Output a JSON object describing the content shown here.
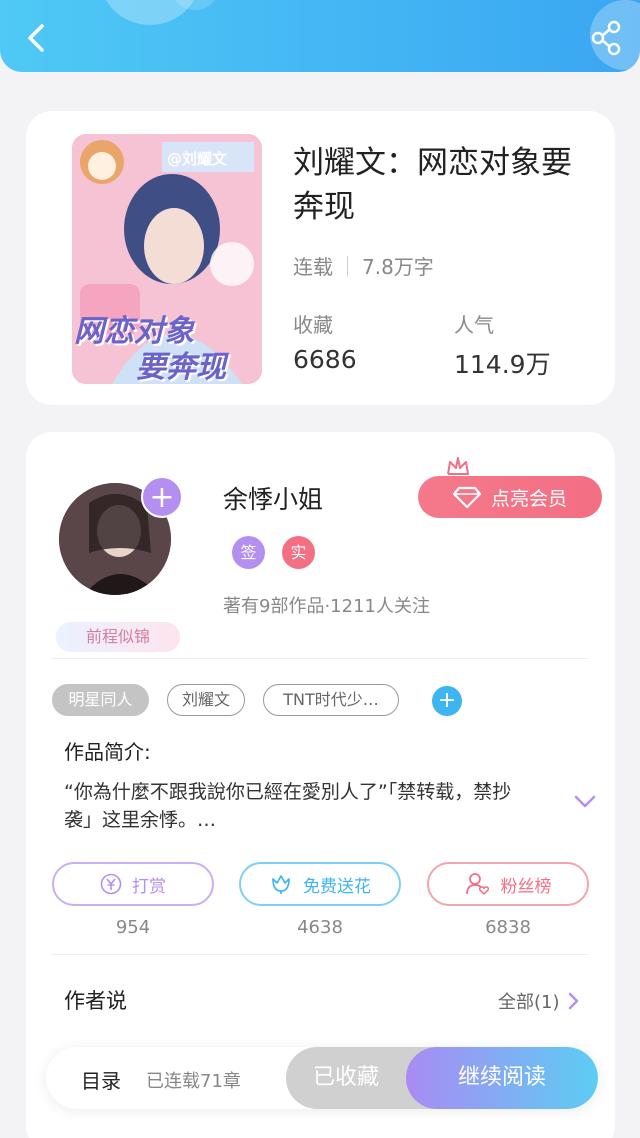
{
  "header": {
    "accent_color": "#3aa6f2",
    "back_icon": "chevron-left-icon",
    "share_icon": "share-icon"
  },
  "book": {
    "title": "刘耀文：网恋对象要奔现",
    "status": "连载",
    "word_count": "7.8万字",
    "collect_label": "收藏",
    "collect_value": "6686",
    "popularity_label": "人气",
    "popularity_value": "114.9万",
    "cover_text_1": "网恋对象",
    "cover_text_2": "要奔现",
    "cover_watermark": "@刘耀文"
  },
  "author": {
    "name": "余悸小姐",
    "badge_sign": "签",
    "badge_real": "实",
    "stats": "著有9部作品·1211人关注",
    "vip_button": "点亮会员",
    "honor_tag": "前程似锦"
  },
  "tags": [
    "明星同人",
    "刘耀文",
    "TNT时代少…"
  ],
  "intro": {
    "label": "作品简介:",
    "text": "“你為什麼不跟我說你已經在愛別人了”「禁转载，禁抄袭」这里余悸。…"
  },
  "actions": [
    {
      "label": "打赏",
      "count": "954",
      "color": "#b58ff0",
      "icon": "yuan-icon"
    },
    {
      "label": "免费送花",
      "count": "4638",
      "color": "#3db5f0",
      "icon": "flower-icon"
    },
    {
      "label": "粉丝榜",
      "count": "6838",
      "color": "#f36f83",
      "icon": "fans-icon"
    }
  ],
  "author_says": {
    "title": "作者说",
    "all_label": "全部(1)"
  },
  "bottom_bar": {
    "toc_label": "目录",
    "chapter_count": "已连载71章",
    "collected_label": "已收藏",
    "read_label": "继续阅读"
  }
}
